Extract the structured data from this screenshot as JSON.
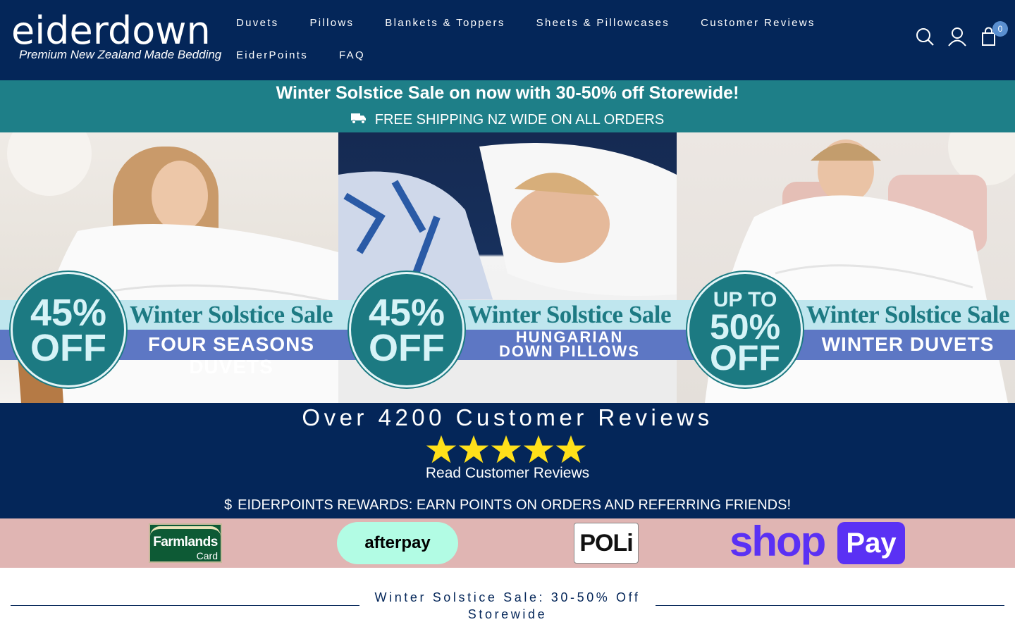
{
  "header": {
    "logo_word": "eiderdown",
    "logo_tagline": "Premium New Zealand Made Bedding",
    "nav_row1": [
      "Duvets",
      "Pillows",
      "Blankets & Toppers",
      "Sheets & Pillowcases",
      "Customer Reviews"
    ],
    "nav_row2": [
      "EiderPoints",
      "FAQ"
    ],
    "cart_count": "0",
    "icons": [
      "search-icon",
      "account-icon",
      "cart-icon"
    ]
  },
  "promo": {
    "headline": "Winter Solstice Sale on now with 30-50% off Storewide!",
    "shipping": "FREE SHIPPING NZ WIDE ON ALL ORDERS",
    "shipping_icon": "truck-icon"
  },
  "banners": [
    {
      "badge_line1": "45%",
      "badge_line2": "OFF",
      "title": "Winter Solstice Sale",
      "subtitle": "FOUR SEASONS DUVETS"
    },
    {
      "badge_line1": "45%",
      "badge_line2": "OFF",
      "title": "Winter Solstice Sale",
      "subtitle_line1": "HUNGARIAN",
      "subtitle_line2": "DOWN PILLOWS"
    },
    {
      "badge_line0": "UP TO",
      "badge_line1": "50%",
      "badge_line2": "OFF",
      "title": "Winter Solstice Sale",
      "subtitle": "WINTER DUVETS"
    }
  ],
  "reviews": {
    "title": "Over 4200 Customer Reviews",
    "rating": 5,
    "link": "Read Customer Reviews",
    "rewards_icon": "dollar-icon",
    "rewards": "EIDERPOINTS REWARDS: EARN POINTS ON ORDERS AND REFERRING FRIENDS!"
  },
  "payments": {
    "farmlands_line1": "Farmlands",
    "farmlands_line2": "Card",
    "afterpay": "afterpay",
    "poli": "POLi",
    "shop": "shop",
    "pay": "Pay"
  },
  "section": {
    "title": "Winter Solstice Sale: 30-50% Off Storewide"
  },
  "colors": {
    "navy": "#042659",
    "teal": "#1e7f88",
    "pink": "#e0b5b3",
    "banner_sky": "#bfe6ee",
    "banner_blue": "#5d77c4"
  }
}
